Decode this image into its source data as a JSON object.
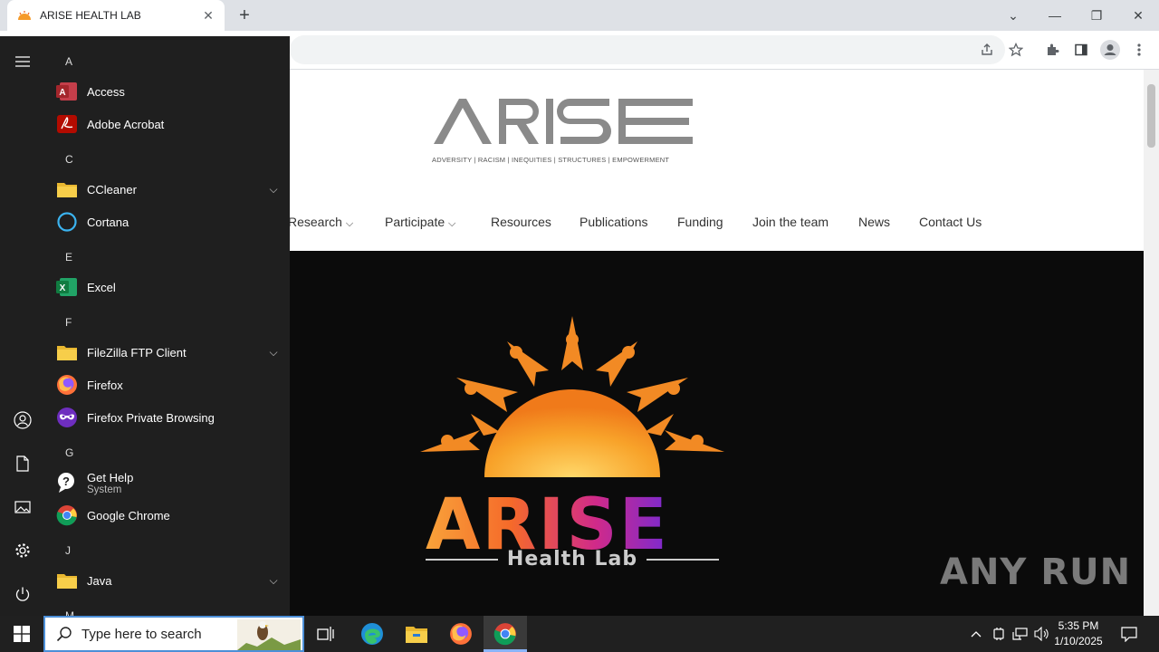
{
  "browser": {
    "tab_title": "ARISE HEALTH LAB"
  },
  "site": {
    "logo_text": "ARISE",
    "tagline": "ADVERSITY | RACISM | INEQUITIES | STRUCTURES | EMPOWERMENT",
    "nav": [
      {
        "label": "Research",
        "dropdown": true
      },
      {
        "label": "Participate",
        "dropdown": true
      },
      {
        "label": "Resources"
      },
      {
        "label": "Publications"
      },
      {
        "label": "Funding"
      },
      {
        "label": "Join the team"
      },
      {
        "label": "News"
      },
      {
        "label": "Contact Us"
      }
    ],
    "hero_word": "ARISE",
    "hero_sub": "Health Lab",
    "watermark": "ANY RUN"
  },
  "start_menu": {
    "groups": [
      {
        "letter": "A"
      },
      {
        "letter": "C"
      },
      {
        "letter": "E"
      },
      {
        "letter": "F"
      },
      {
        "letter": "G"
      },
      {
        "letter": "J"
      },
      {
        "letter": "M"
      }
    ],
    "apps": [
      {
        "label": "Access",
        "icon": "access-icon"
      },
      {
        "label": "Adobe Acrobat",
        "icon": "acrobat-icon"
      },
      {
        "label": "CCleaner",
        "icon": "folder-icon",
        "expandable": true
      },
      {
        "label": "Cortana",
        "icon": "cortana-icon"
      },
      {
        "label": "Excel",
        "icon": "excel-icon"
      },
      {
        "label": "FileZilla FTP Client",
        "icon": "folder-icon",
        "expandable": true
      },
      {
        "label": "Firefox",
        "icon": "firefox-icon"
      },
      {
        "label": "Firefox Private Browsing",
        "icon": "firefox-private-icon"
      },
      {
        "label": "Get Help",
        "sublabel": "System",
        "icon": "get-help-icon"
      },
      {
        "label": "Google Chrome",
        "icon": "chrome-icon"
      },
      {
        "label": "Java",
        "icon": "folder-icon",
        "expandable": true
      }
    ]
  },
  "taskbar": {
    "search_placeholder": "Type here to search",
    "time": "5:35 PM",
    "date": "1/10/2025"
  }
}
